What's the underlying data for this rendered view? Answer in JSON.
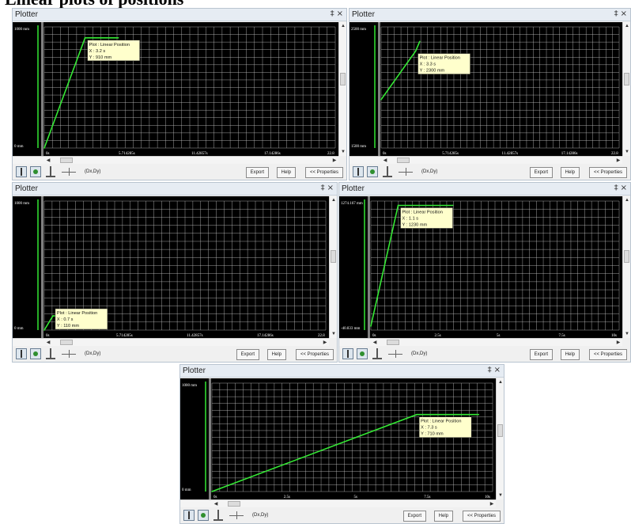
{
  "banner": {
    "text": "Linear plots of positions"
  },
  "buttons": {
    "dxdy": "(Dx,Dy)",
    "export": "Export",
    "help": "Help",
    "properties": "<< Properties"
  },
  "window_controls": {
    "pin": "‡",
    "close": "×"
  },
  "colors": {
    "plot_bg": "#000000",
    "grid": "#c8c8c8",
    "trace": "#35e835",
    "axis": "#32e832",
    "tooltip_bg": "#ffffcc"
  },
  "icons": [
    "cursor-tool-icon",
    "zoom-tool-icon",
    "vertical-cursor-icon",
    "dxdy-icon"
  ],
  "plots": [
    {
      "title": "Plotter",
      "y_top": "1000 mm",
      "y_bottom": "0 mm",
      "x_ticks": [
        "0s",
        "5.714285s",
        "11.42857s",
        "17.14286s",
        "22.8"
      ],
      "tooltip": {
        "title": "Plot : Linear Position",
        "x": "X : 3.2 s",
        "y": "Y : 910 mm"
      },
      "chart_data": {
        "type": "line",
        "xlim": [
          0,
          22.8
        ],
        "ylim": [
          0,
          1000
        ],
        "x": [
          0,
          3.2,
          5.8
        ],
        "y": [
          0,
          910,
          910
        ],
        "xlabel": "",
        "ylabel": ""
      }
    },
    {
      "title": "Plotter",
      "y_top": "2500 mm",
      "y_bottom": "1500 mm",
      "x_ticks": [
        "0s",
        "5.714285s",
        "11.42857s",
        "17.14286s",
        "22.8"
      ],
      "tooltip": {
        "title": "Plot : Linear Position",
        "x": "X : 3.3 s",
        "y": "Y : 2300 mm"
      },
      "chart_data": {
        "type": "line",
        "xlim": [
          0,
          22.8
        ],
        "ylim": [
          1500,
          2500
        ],
        "x": [
          0,
          3.3,
          3.7
        ],
        "y": [
          1900,
          2300,
          2380
        ],
        "xlabel": "",
        "ylabel": ""
      }
    },
    {
      "title": "Plotter",
      "y_top": "1000 mm",
      "y_bottom": "0 mm",
      "x_ticks": [
        "0s",
        "5.714285s",
        "11.42857s",
        "17.14286s",
        "22.8"
      ],
      "tooltip": {
        "title": "Plot : Linear Position",
        "x": "X : 0.7 s",
        "y": "Y : 110 mm"
      },
      "chart_data": {
        "type": "line",
        "xlim": [
          0,
          22.8
        ],
        "ylim": [
          0,
          1000
        ],
        "x": [
          0,
          0.7,
          2.0
        ],
        "y": [
          0,
          110,
          110
        ],
        "xlabel": "",
        "ylabel": ""
      }
    },
    {
      "title": "Plotter",
      "y_top": "1274.167 mm",
      "y_bottom": "-40.833 mm",
      "x_ticks": [
        "0s",
        "2.5s",
        "5s",
        "7.5s",
        "10s"
      ],
      "tooltip": {
        "title": "Plot : Linear Position",
        "x": "X : 1.1 s",
        "y": "Y : 1230 mm"
      },
      "chart_data": {
        "type": "line",
        "xlim": [
          0,
          10
        ],
        "ylim": [
          -40.833,
          1274.167
        ],
        "x": [
          0,
          1.1,
          3.3
        ],
        "y": [
          0,
          1230,
          1230
        ],
        "xlabel": "",
        "ylabel": ""
      }
    },
    {
      "title": "Plotter",
      "y_top": "1000 mm",
      "y_bottom": "0 mm",
      "x_ticks": [
        "0s",
        "2.5s",
        "5s",
        "7.5s",
        "10s"
      ],
      "tooltip": {
        "title": "Plot : Linear Position",
        "x": "X : 7.3 s",
        "y": "Y : 710 mm"
      },
      "chart_data": {
        "type": "line",
        "xlim": [
          0,
          10
        ],
        "ylim": [
          0,
          1000
        ],
        "x": [
          0,
          7.3,
          9.5
        ],
        "y": [
          0,
          710,
          710
        ],
        "xlabel": "",
        "ylabel": ""
      }
    }
  ]
}
